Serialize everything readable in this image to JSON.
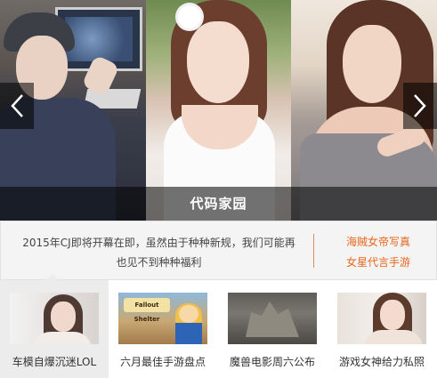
{
  "slider": {
    "caption": "代码家园",
    "prev_icon": "chevron-left-icon",
    "next_icon": "chevron-right-icon"
  },
  "info": {
    "description_line1": "2015年CJ即将开幕在即，虽然由于种种新规，我们可能再",
    "description_line2": "也见不到种种福利",
    "links": [
      "海贼女帝写真",
      "女星代言手游"
    ]
  },
  "thumbs": [
    {
      "label": "车模自爆沉迷LOL",
      "active": true
    },
    {
      "label": "六月最佳手游盘点",
      "logo_text": "Fallout Shelter"
    },
    {
      "label": "魔兽电影周六公布"
    },
    {
      "label": "游戏女神给力私照"
    }
  ],
  "colors": {
    "accent_link": "#e8661c",
    "overlay": "#000000",
    "panel_bg": "#f4f4f4"
  }
}
